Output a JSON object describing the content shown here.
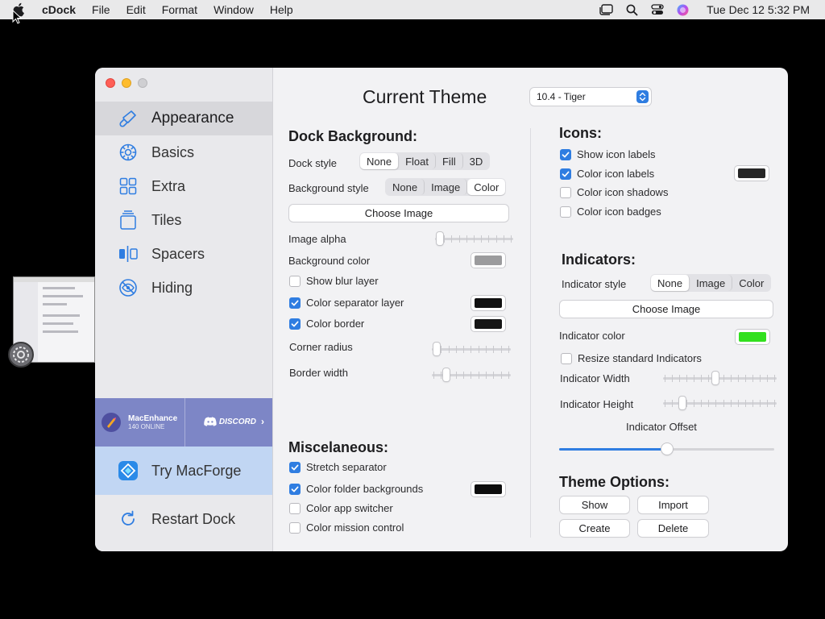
{
  "menubar": {
    "app": "cDock",
    "items": [
      "File",
      "Edit",
      "Format",
      "Window",
      "Help"
    ],
    "clock": "Tue Dec 12  5:32 PM"
  },
  "sidebar": {
    "items": [
      {
        "label": "Appearance",
        "icon": "brush-icon"
      },
      {
        "label": "Basics",
        "icon": "gear-icon"
      },
      {
        "label": "Extra",
        "icon": "grid-icon"
      },
      {
        "label": "Tiles",
        "icon": "tiles-icon"
      },
      {
        "label": "Spacers",
        "icon": "spacers-icon"
      },
      {
        "label": "Hiding",
        "icon": "eye-slash-icon"
      }
    ],
    "banner": {
      "name": "MacEnhance",
      "online": "140 ONLINE",
      "discord": "DISCORD"
    },
    "try_macforge": "Try MacForge",
    "restart_dock": "Restart Dock"
  },
  "main": {
    "title": "Current Theme",
    "theme_select": "10.4 - Tiger",
    "dock_background": {
      "heading": "Dock Background:",
      "dock_style": {
        "label": "Dock style",
        "options": [
          "None",
          "Float",
          "Fill",
          "3D"
        ],
        "selected": "None"
      },
      "background_style": {
        "label": "Background style",
        "options": [
          "None",
          "Image",
          "Color"
        ],
        "selected": "Color"
      },
      "choose_image": "Choose Image",
      "image_alpha": {
        "label": "Image alpha",
        "value": 0.02
      },
      "background_color": {
        "label": "Background color",
        "color": "#9b9b9d"
      },
      "show_blur": {
        "label": "Show blur layer",
        "checked": false
      },
      "color_separator": {
        "label": "Color separator layer",
        "checked": true,
        "color": "#111111"
      },
      "color_border": {
        "label": "Color border",
        "checked": true,
        "color": "#161616"
      },
      "corner_radius": {
        "label": "Corner radius",
        "value": 0.02
      },
      "border_width": {
        "label": "Border width",
        "value": 0.15
      }
    },
    "misc": {
      "heading": "Miscelaneous:",
      "stretch_separator": {
        "label": "Stretch separator",
        "checked": true
      },
      "color_folder": {
        "label": "Color folder backgrounds",
        "checked": true,
        "color": "#0d0d0d"
      },
      "color_app_switcher": {
        "label": "Color app switcher",
        "checked": false
      },
      "color_mission_control": {
        "label": "Color mission control",
        "checked": false
      }
    },
    "icons": {
      "heading": "Icons:",
      "show_labels": {
        "label": "Show icon labels",
        "checked": true
      },
      "color_labels": {
        "label": "Color icon labels",
        "checked": true,
        "color": "#262626"
      },
      "color_shadows": {
        "label": "Color icon shadows",
        "checked": false
      },
      "color_badges": {
        "label": "Color icon badges",
        "checked": false
      }
    },
    "indicators": {
      "heading": "Indicators:",
      "indicator_style": {
        "label": "Indicator style",
        "options": [
          "None",
          "Image",
          "Color"
        ],
        "selected": "None"
      },
      "choose_image": "Choose Image",
      "indicator_color": {
        "label": "Indicator color",
        "color": "#32e01e"
      },
      "resize_standard": {
        "label": "Resize standard Indicators",
        "checked": false
      },
      "width": {
        "label": "Indicator Width",
        "value": 0.46
      },
      "height": {
        "label": "Indicator Height",
        "value": 0.15
      },
      "offset": {
        "label": "Indicator Offset",
        "value": 0.5
      }
    },
    "theme_options": {
      "heading": "Theme Options:",
      "buttons": [
        "Show",
        "Import",
        "Create",
        "Delete"
      ]
    }
  },
  "colors": {
    "accent": "#2f7de1",
    "sidebar_selected": "#d7d7db",
    "banner": "#7d86c6",
    "macforge": "#c1d6f3"
  }
}
